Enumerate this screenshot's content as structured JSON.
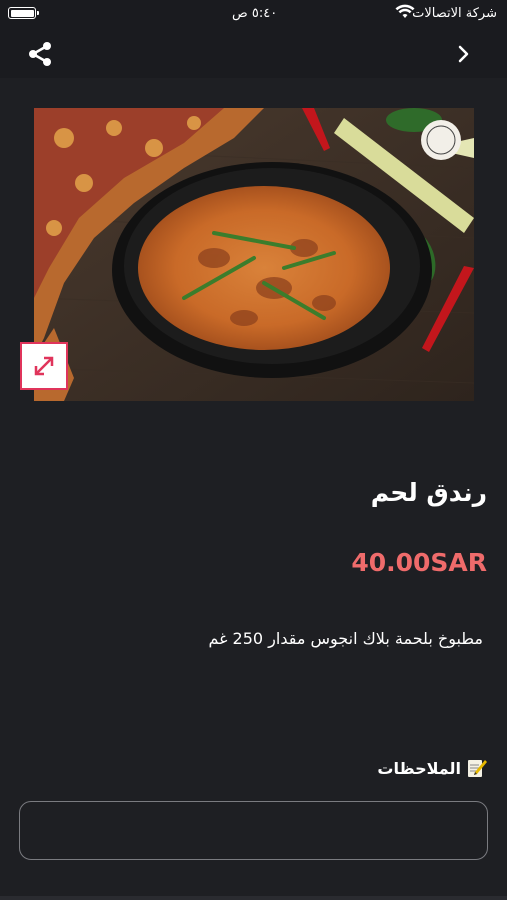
{
  "status_bar": {
    "carrier": "شركة الاتصالات",
    "time": "٥:٤٠ ص"
  },
  "nav": {
    "back_icon": "chevron-right-icon",
    "share_icon": "share-icon"
  },
  "product": {
    "image_alt": "",
    "name": "رندق لحم",
    "price": "40.00SAR",
    "description": "مطبوخ بلحمة بلاك انجوس مقدار 250 غم"
  },
  "notes": {
    "label": "الملاحظات",
    "icon": "memo-icon",
    "value": "",
    "placeholder": ""
  },
  "colors": {
    "background": "#1e1f23",
    "price": "#ef6b6b",
    "accent": "#e0345b"
  }
}
